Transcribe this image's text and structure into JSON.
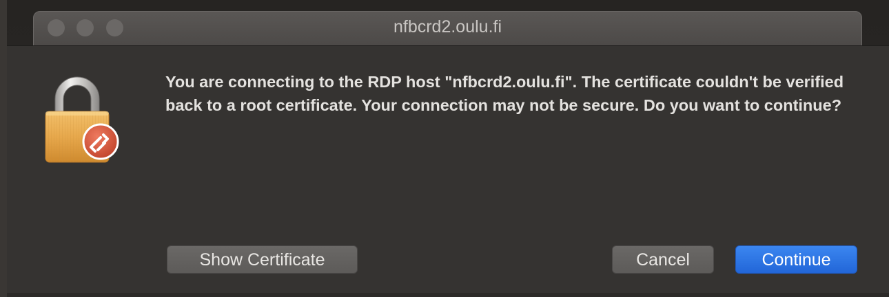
{
  "window": {
    "title": "nfbcrd2.oulu.fi"
  },
  "dialog": {
    "message": "You are connecting to the RDP host \"nfbcrd2.oulu.fi\". The certificate couldn't be verified back to a root certificate. Your connection may not be secure. Do you want to continue?",
    "buttons": {
      "show_certificate": "Show Certificate",
      "cancel": "Cancel",
      "continue": "Continue"
    }
  },
  "icons": {
    "lock": "padlock-icon",
    "rdp_badge": "remote-desktop-badge-icon"
  },
  "colors": {
    "accent": "#2a6fe0",
    "badge": "#d9553b",
    "lock_body": "#e8a94e"
  }
}
